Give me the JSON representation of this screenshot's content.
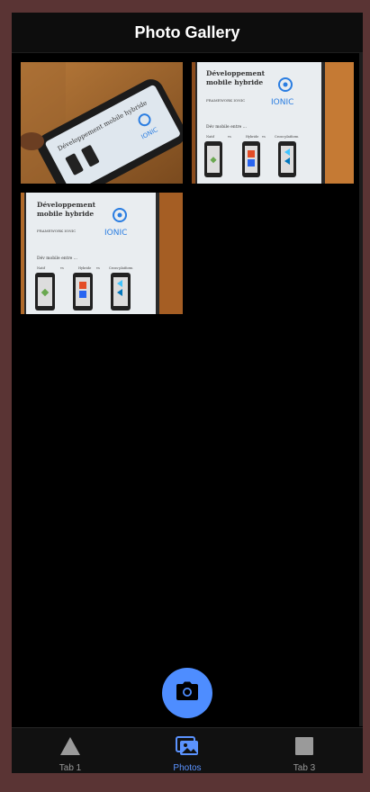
{
  "header": {
    "title": "Photo Gallery"
  },
  "gallery": {
    "photos": [
      {
        "name": "photo-1",
        "screen_title": "Développement mobile hybride",
        "logo": "IONIC"
      },
      {
        "name": "photo-2",
        "screen_title": "Développement mobile hybride",
        "subtitle": "FRAMEWORK IONIC",
        "logo": "IONIC",
        "caption": "Dév mobile entre ...",
        "labels": [
          "Natif",
          "vs",
          "Hybride",
          "vs",
          "Cross-platform"
        ]
      },
      {
        "name": "photo-3",
        "screen_title": "Développement mobile hybride",
        "subtitle": "FRAMEWORK IONIC",
        "logo": "IONIC",
        "caption": "Dév mobile entre ...",
        "labels": [
          "Natif",
          "vs",
          "Hybride",
          "vs",
          "Cross-platform"
        ]
      }
    ]
  },
  "fab": {
    "icon": "camera-icon"
  },
  "tabs": [
    {
      "label": "Tab 1",
      "icon": "triangle-icon",
      "active": false
    },
    {
      "label": "Photos",
      "icon": "images-icon",
      "active": true
    },
    {
      "label": "Tab 3",
      "icon": "square-icon",
      "active": false
    }
  ],
  "colors": {
    "accent": "#4e8dff",
    "background": "#000000",
    "frame": "#5a3434"
  }
}
